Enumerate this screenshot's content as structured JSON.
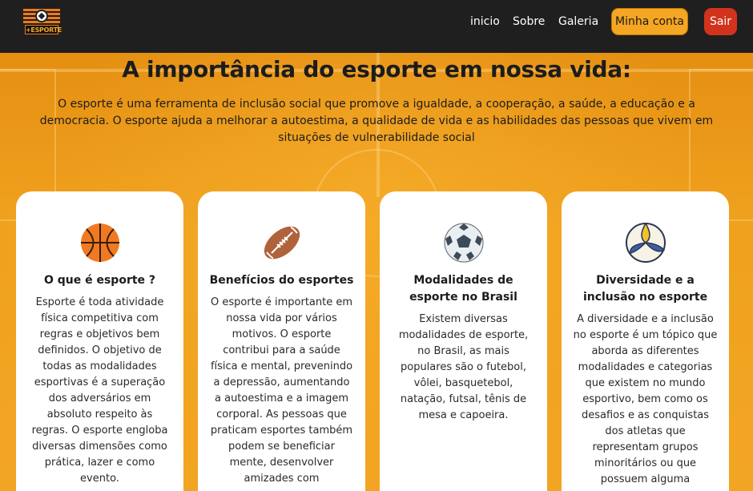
{
  "header": {
    "logo_text": "+ESPORTE",
    "nav": [
      {
        "label": "inicio"
      },
      {
        "label": "Sobre"
      },
      {
        "label": "Galeria"
      }
    ],
    "account_button": "Minha conta",
    "exit_button": "Sair"
  },
  "hero": {
    "title": "A importância do esporte em nossa vida:",
    "intro": "O esporte é uma ferramenta de inclusão social que promove a igualdade, a cooperação, a saúde, a educação e a democracia. O esporte ajuda a melhorar a autoestima, a qualidade de vida e as habilidades das pessoas que vivem em situações de vulnerabilidade social"
  },
  "cards": [
    {
      "icon": "basketball-icon",
      "title": "O que é esporte ?",
      "text": "Esporte é toda atividade física competitiva com regras e objetivos bem definidos. O objetivo de todas as modalidades esportivas é a superação dos adversários em absoluto respeito às regras. O esporte engloba diversas dimensões como prática, lazer e como evento."
    },
    {
      "icon": "american-football-icon",
      "title": "Benefícios do esportes",
      "text": "O esporte é importante em nossa vida por vários motivos. O esporte contribui para a saúde física e mental, prevenindo a depressão, aumentando a autoestima e a imagem corporal. As pessoas que praticam esportes também podem se beneficiar mente, desenvolver amizades com"
    },
    {
      "icon": "soccer-ball-icon",
      "title": "Modalidades de esporte no Brasil",
      "text": "Existem diversas modalidades de esporte, no Brasil, as mais populares são o futebol, vôlei, basquetebol, natação, futsal, tênis de mesa e capoeira."
    },
    {
      "icon": "volleyball-icon",
      "title": "Diversidade e a inclusão no esporte",
      "text": "A diversidade e a inclusão no esporte é um tópico que aborda as diferentes modalidades e categorias que existem no mundo esportivo, bem como os desafios e as conquistas dos atletas que representam grupos minoritários ou que possuem alguma"
    }
  ],
  "colors": {
    "header_bg": "#1f1f1f",
    "accent_orange": "#f5a623",
    "exit_red": "#d2331c",
    "hero_orange": "#f0a020"
  }
}
